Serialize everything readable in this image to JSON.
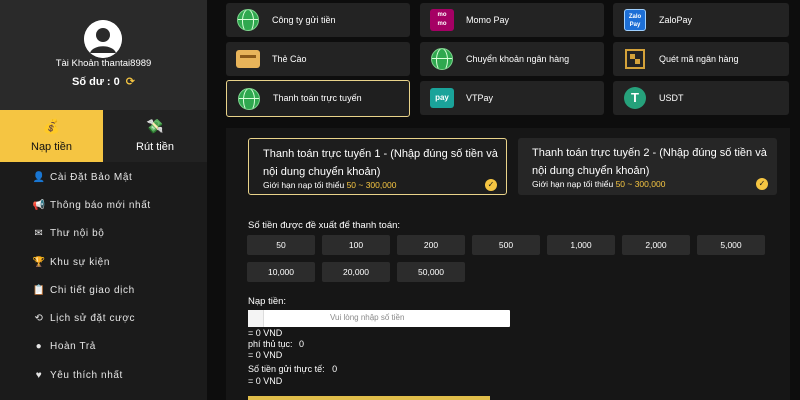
{
  "sidebar": {
    "account_label": "Tài Khoản thantai8989",
    "balance_label": "Số dư :",
    "balance_value": "0",
    "tabs": [
      {
        "label": "Nạp tiền",
        "active": true
      },
      {
        "label": "Rút tiền",
        "active": false
      }
    ],
    "menu": [
      {
        "label": "Cài Đặt Bảo Mật",
        "icon": "user-lock-icon"
      },
      {
        "label": "Thông báo mới nhất",
        "icon": "megaphone-icon"
      },
      {
        "label": "Thư nội bộ",
        "icon": "envelope-icon"
      },
      {
        "label": "Khu sự kiện",
        "icon": "trophy-icon"
      },
      {
        "label": "Chi tiết giao dịch",
        "icon": "clipboard-icon"
      },
      {
        "label": "Lịch sử đặt cược",
        "icon": "history-icon"
      },
      {
        "label": "Hoàn Trả",
        "icon": "coins-icon"
      },
      {
        "label": "Yêu thích nhất",
        "icon": "heart-icon"
      }
    ]
  },
  "methods": [
    {
      "label": "Công ty gửi tiền",
      "icon": "globe-icon"
    },
    {
      "label": "Momo Pay",
      "icon": "momo-icon",
      "icon_text_1": "mo",
      "icon_text_2": "mo"
    },
    {
      "label": "ZaloPay",
      "icon": "zalopay-icon",
      "icon_text_1": "Zalo",
      "icon_text_2": "Pay"
    },
    {
      "label": "Thẻ Cào",
      "icon": "card-icon"
    },
    {
      "label": "Chuyển khoản ngân hàng",
      "icon": "globe-icon"
    },
    {
      "label": "Quét mã ngân hàng",
      "icon": "qr-icon"
    },
    {
      "label": "Thanh toán trực tuyến",
      "icon": "globe-icon",
      "active": true
    },
    {
      "label": "VTPay",
      "icon": "vtpay-icon",
      "icon_text_1": "pay"
    },
    {
      "label": "USDT",
      "icon": "usdt-icon",
      "icon_text_1": "T"
    }
  ],
  "options": [
    {
      "title": "Thanh toán trực tuyến 1 - (Nhập đúng số tiền và nội dung chuyển khoản)",
      "limit_label": "Giới hạn nạp tối thiểu",
      "limit_range": "50 ~ 300,000",
      "active": true
    },
    {
      "title": "Thanh toán trực tuyến 2 - (Nhập đúng số tiền và nội dung chuyển khoản)",
      "limit_label": "Giới hạn nạp tối thiểu",
      "limit_range": "50 ~ 300,000",
      "active": false
    }
  ],
  "suggested": {
    "label": "Số tiền được đề xuất để thanh toán:",
    "amounts": [
      "50",
      "100",
      "200",
      "500",
      "1,000",
      "2,000",
      "5,000",
      "10,000",
      "20,000",
      "50,000"
    ]
  },
  "deposit": {
    "label": "Nạp tiền:",
    "placeholder": "Vui lòng nhập số tiền",
    "value": "",
    "converted": "= 0 VND",
    "fee_label": "phí thủ tục:",
    "fee_value": "0",
    "fee_converted": "= 0 VND",
    "actual_label": "Số tiền gửi thực tế:",
    "actual_value": "0",
    "actual_converted": "= 0 VND"
  },
  "colors": {
    "accent": "#f5c542",
    "active_border": "#e9d38a",
    "background": "#0d0d0d"
  }
}
